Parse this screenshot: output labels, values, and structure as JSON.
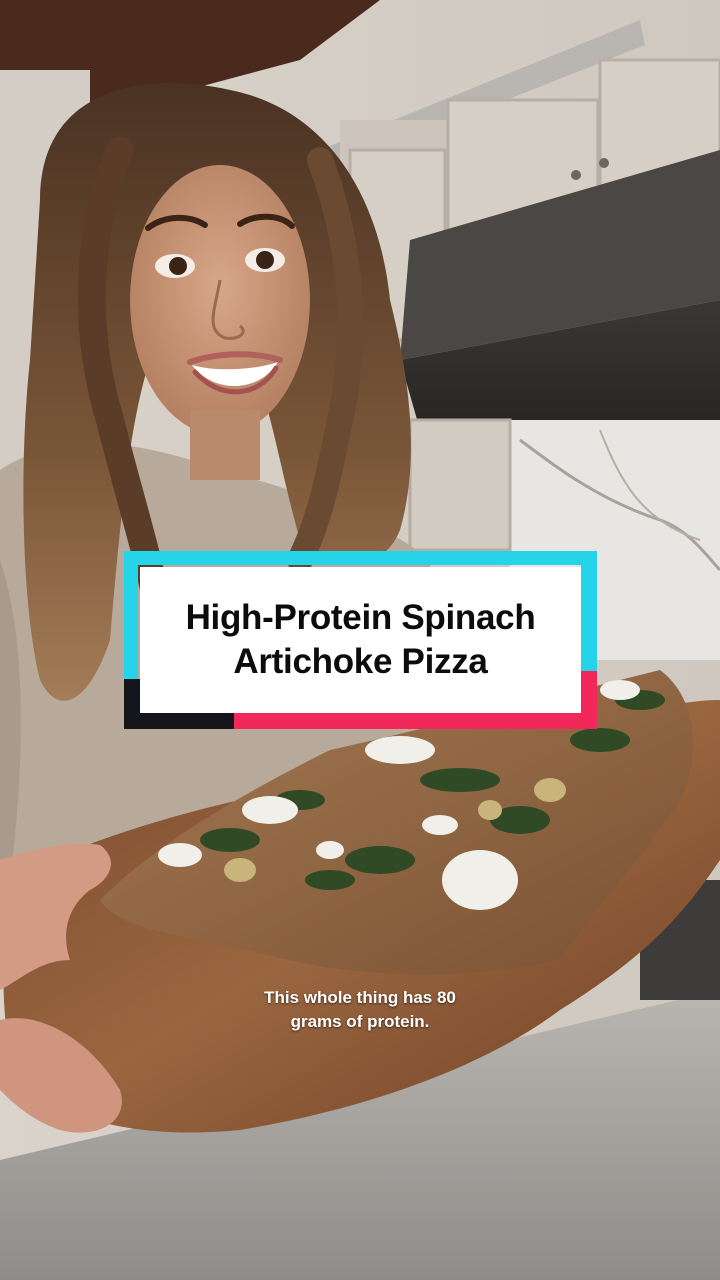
{
  "video": {
    "title_line1": "High-Protein Spinach",
    "title_line2": "Artichoke Pizza",
    "caption_line1": "This whole thing has 80",
    "caption_line2": "grams of protein."
  },
  "colors": {
    "accent_cyan": "#25d4e8",
    "accent_pink": "#f2285a",
    "accent_dark": "#14161c",
    "card_bg": "#ffffff",
    "caption_text": "#ffffff"
  }
}
